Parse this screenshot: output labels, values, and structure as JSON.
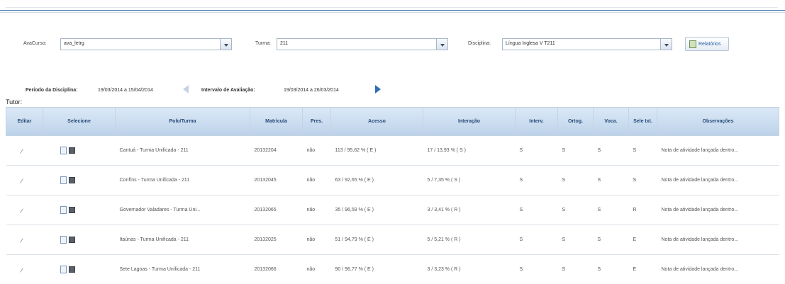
{
  "filters": {
    "avacurso_label": "AvaCurso:",
    "avacurso_value": "ava_letrg",
    "turma_label": "Turma:",
    "turma_value": "211",
    "disciplina_label": "Disciplina:",
    "disciplina_value": "Língua Inglesa V T211",
    "report_label": "Relatórios"
  },
  "period": {
    "disciplina_label": "Período da Disciplina:",
    "disciplina_value": "19/03/2014 a 15/04/2014",
    "avaliacao_label": "Intervalo de Avaliação:",
    "avaliacao_value": "19/03/2014 a 26/03/2014"
  },
  "tutor_label": "Tutor:",
  "table": {
    "headers": [
      "Editar",
      "Selecione",
      "Polo/Turma",
      "Matrícula",
      "Pres.",
      "Acesso",
      "Interação",
      "Interv.",
      "Ortog.",
      "Voca.",
      "Sele txt.",
      "Observações"
    ],
    "rows": [
      [
        "Cantuá - Turma Unificada - 211",
        "20132204",
        "não",
        "113 / 95,62 % ( E )",
        "17 / 13,93 % ( S )",
        "S",
        "S",
        "S",
        "S",
        "Nota de atividade lançada dentro..."
      ],
      [
        "Conf/ns - Turma Unificada - 211",
        "20132045",
        "não",
        "63 / 92,65 % ( E )",
        "5 / 7,35 % ( S )",
        "S",
        "S",
        "S",
        "S",
        "Nota de atividade lançada dentro..."
      ],
      [
        "Governador Valadares - Turma Uni...",
        "20132065",
        "não",
        "35 / 96,59 % ( E )",
        "3 / 3,41 % ( R )",
        "S",
        "S",
        "S",
        "R",
        "Nota de atividade lançada dentro..."
      ],
      [
        "Itaúnas - Turma Unificada - 211",
        "20132025",
        "não",
        "51 / 94,79 % ( E )",
        "5 / 5,21 % ( R )",
        "S",
        "S",
        "S",
        "E",
        "Nota de atividade lançada dentro..."
      ],
      [
        "Sete Lagoas - Turma Unificada - 211",
        "20132066",
        "não",
        "90 / 96,77 % ( E )",
        "3 / 3,23 % ( R )",
        "S",
        "S",
        "S",
        "E",
        "Nota de atividade lançada dentro..."
      ]
    ]
  },
  "icons": {
    "edit": "pencil-icon",
    "view": "document-icon",
    "print": "printer-icon",
    "prev": "chevron-left-icon",
    "next": "chevron-right-icon",
    "report": "report-icon"
  }
}
